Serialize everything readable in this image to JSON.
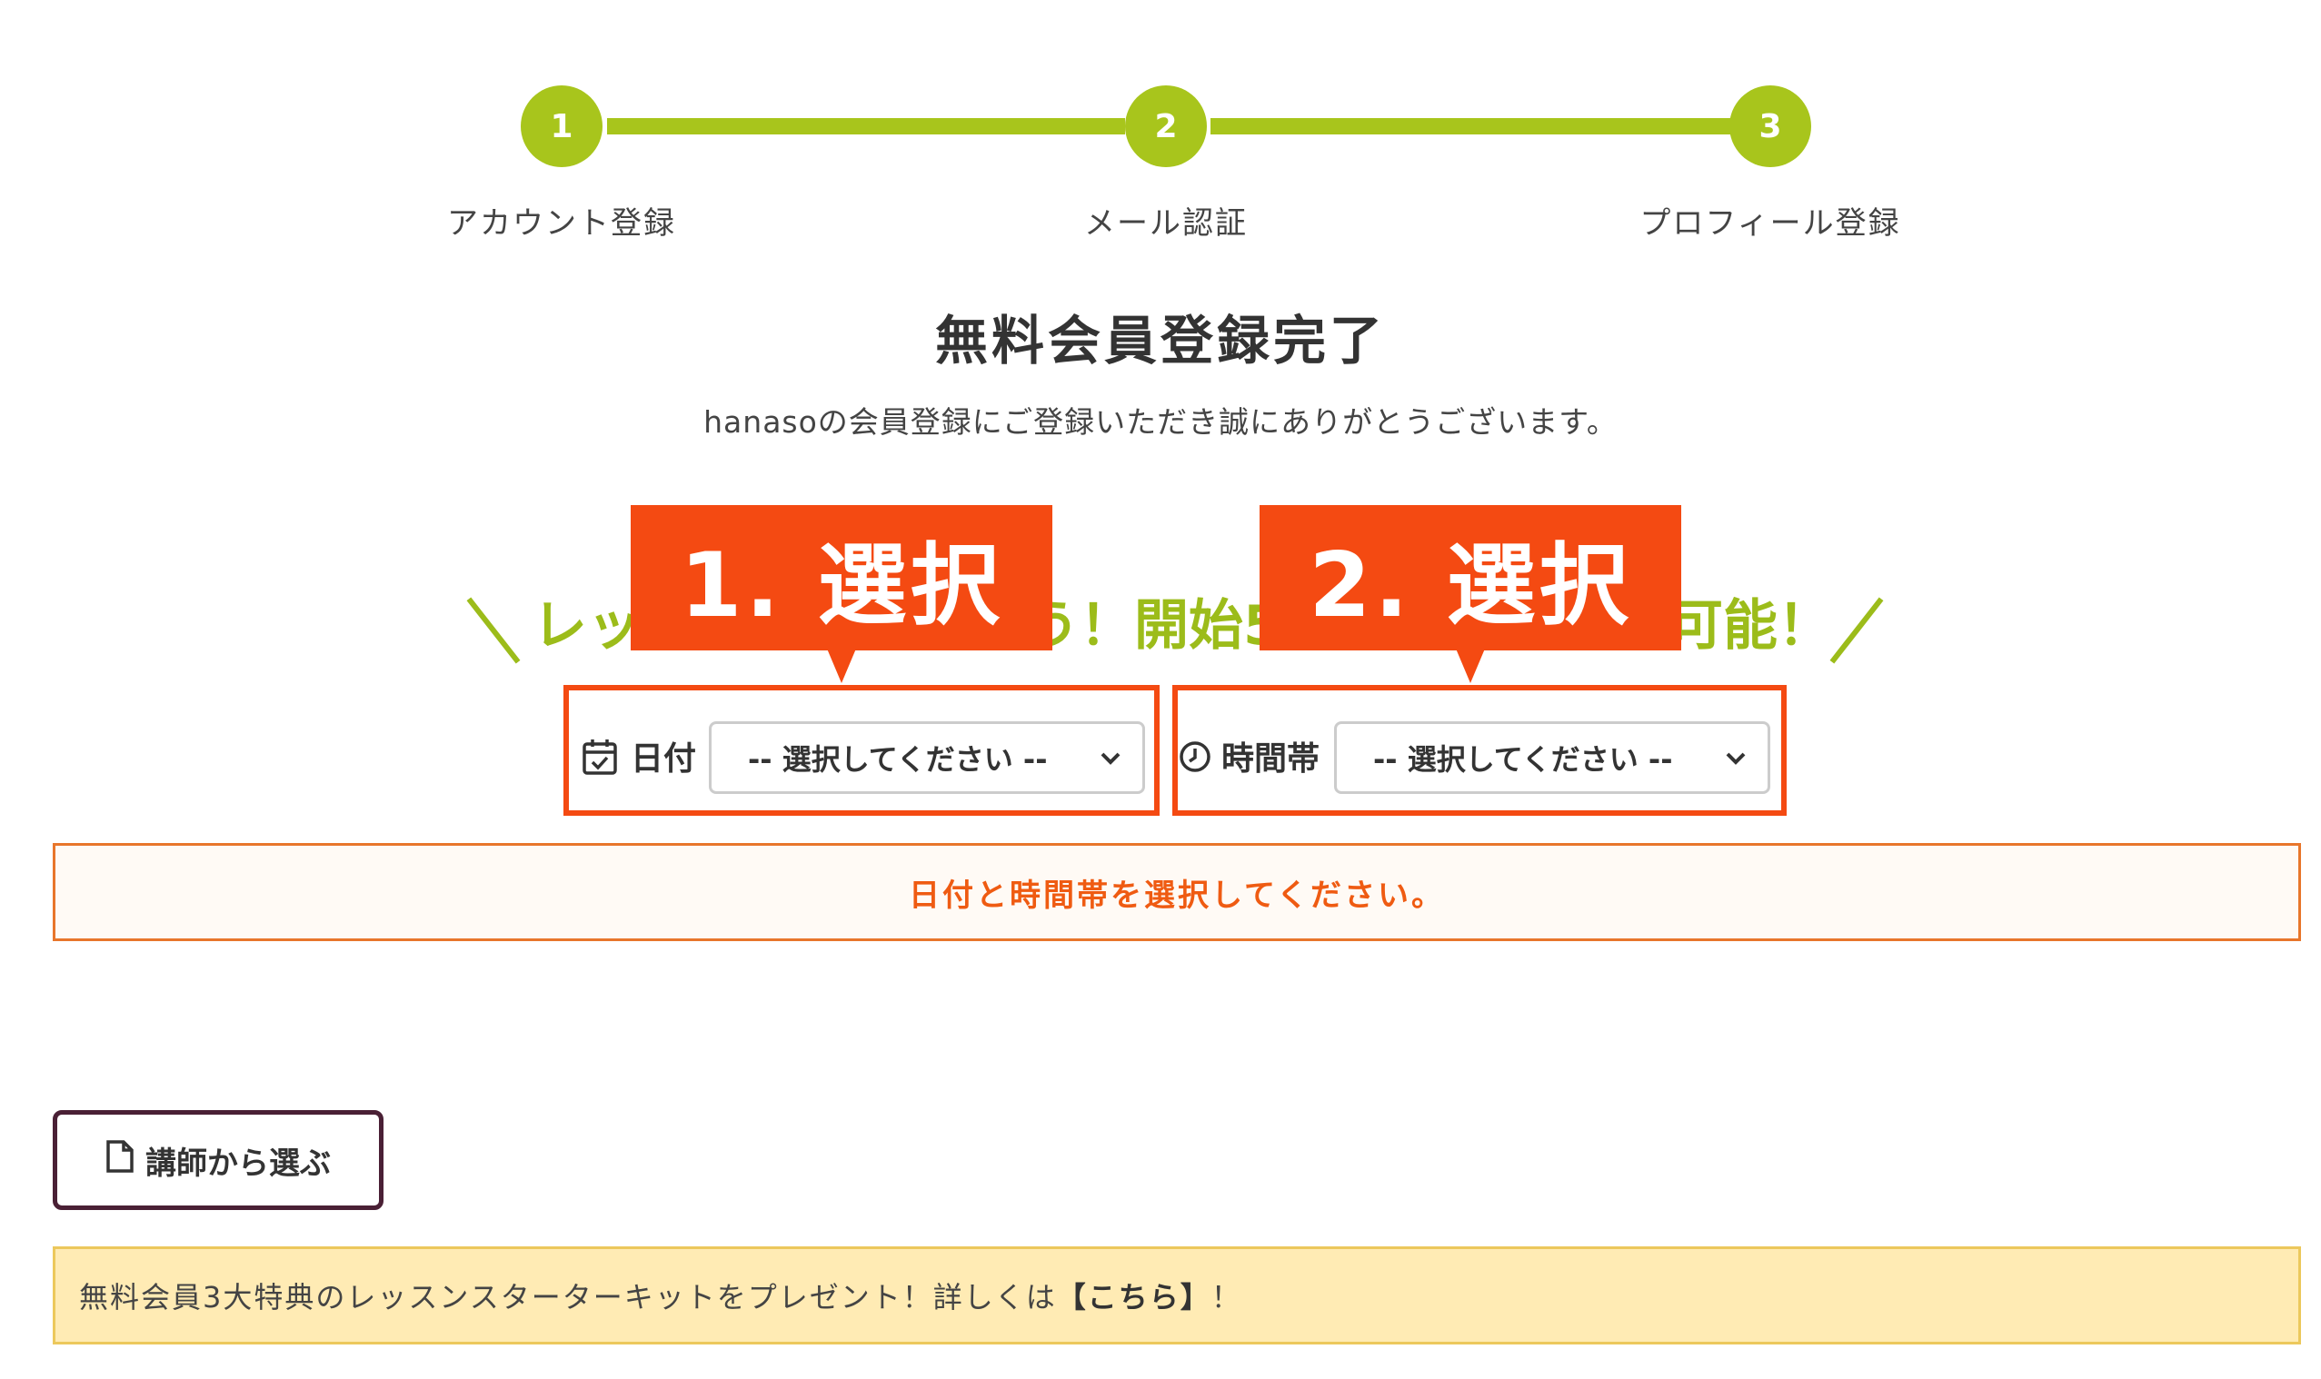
{
  "stepper": {
    "steps": [
      {
        "number": "1",
        "label": "アカウント登録"
      },
      {
        "number": "2",
        "label": "メール認証"
      },
      {
        "number": "3",
        "label": "プロフィール登録"
      }
    ],
    "accent_color": "#a8c51c"
  },
  "header": {
    "title": "無料会員登録完了",
    "subtitle": "hanasoの会員登録にご登録いただき誠にありがとうございます。"
  },
  "slogan": {
    "part1": "レッ",
    "part2": "う！開始5",
    "part3": "可能！"
  },
  "callouts": {
    "first": "1. 選択",
    "second": "2. 選択",
    "color": "#f44a12"
  },
  "form": {
    "date_label": "日付",
    "date_select": "-- 選択してください --",
    "time_label": "時間帯",
    "time_select": "-- 選択してください --"
  },
  "error": {
    "message": "日付と時間帯を選択してください。"
  },
  "teacher_button": {
    "label": "講師から選ぶ"
  },
  "promo": {
    "text_before": "無料会員3大特典のレッスンスターターキットをプレゼント！詳しくは",
    "link": "【こちら】",
    "text_after": "！"
  }
}
